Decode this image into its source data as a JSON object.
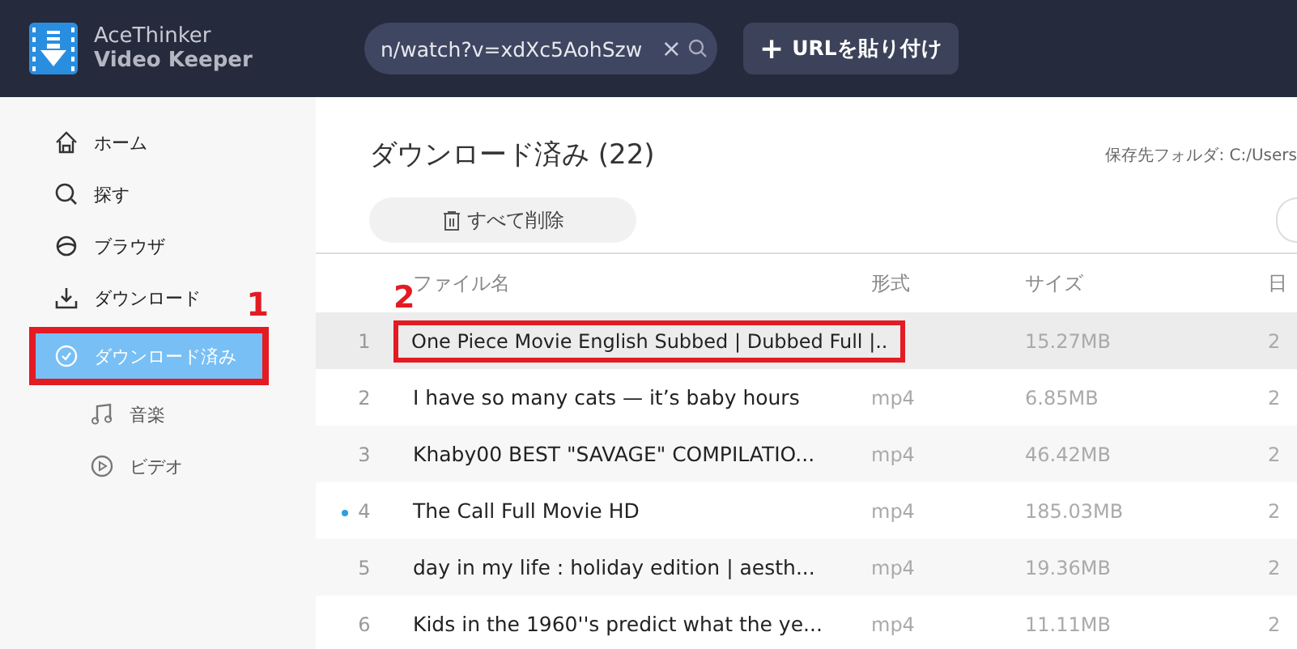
{
  "app": {
    "brand_line1": "AceThinker",
    "brand_line2": "Video Keeper"
  },
  "search": {
    "value": "n/watch?v=xdXc5AohSzw",
    "clear": "×"
  },
  "paste_button": {
    "icon": "+",
    "label": "URLを貼り付け"
  },
  "sidebar": {
    "items": [
      {
        "label": "ホーム",
        "kind": "home",
        "selected": false
      },
      {
        "label": "探す",
        "kind": "search",
        "selected": false
      },
      {
        "label": "ブラウザ",
        "kind": "browser",
        "selected": false
      },
      {
        "label": "ダウンロード",
        "kind": "download",
        "selected": false
      },
      {
        "label": "ダウンロード済み",
        "kind": "done",
        "selected": true,
        "children": [
          {
            "label": "音楽",
            "kind": "music",
            "selected": false
          },
          {
            "label": "ビデオ",
            "kind": "video",
            "selected": false
          }
        ]
      }
    ]
  },
  "content": {
    "title": "ダウンロード済み (22)",
    "folder_label": "保存先フォルダ: C:/Users",
    "delete_all": "すべて削除"
  },
  "table": {
    "columns": [
      "ファイル名",
      "形式",
      "サイズ",
      "日"
    ],
    "rows": [
      {
        "num": "1",
        "title": "One Piece Movie English Subbed | Dubbed Full |..",
        "format": "",
        "size": "15.27MB",
        "date": "2",
        "selected": true,
        "new": false
      },
      {
        "num": "2",
        "title": "I have so many cats — it’s baby hours",
        "format": "mp4",
        "size": "6.85MB",
        "date": "2",
        "selected": false,
        "new": false
      },
      {
        "num": "3",
        "title": "Khaby00 BEST \"SAVAGE\" COMPILATIO...",
        "format": "mp4",
        "size": "46.42MB",
        "date": "2",
        "selected": false,
        "new": false
      },
      {
        "num": "4",
        "title": "The Call Full Movie HD",
        "format": "mp4",
        "size": "185.03MB",
        "date": "2",
        "selected": false,
        "new": true
      },
      {
        "num": "5",
        "title": "day in my life : holiday edition | aesth...",
        "format": "mp4",
        "size": "19.36MB",
        "date": "2",
        "selected": false,
        "new": false
      },
      {
        "num": "6",
        "title": "Kids in the 1960''s predict what the ye...",
        "format": "mp4",
        "size": "11.11MB",
        "date": "2",
        "selected": false,
        "new": false
      }
    ]
  },
  "annotations": [
    "1",
    "2"
  ]
}
